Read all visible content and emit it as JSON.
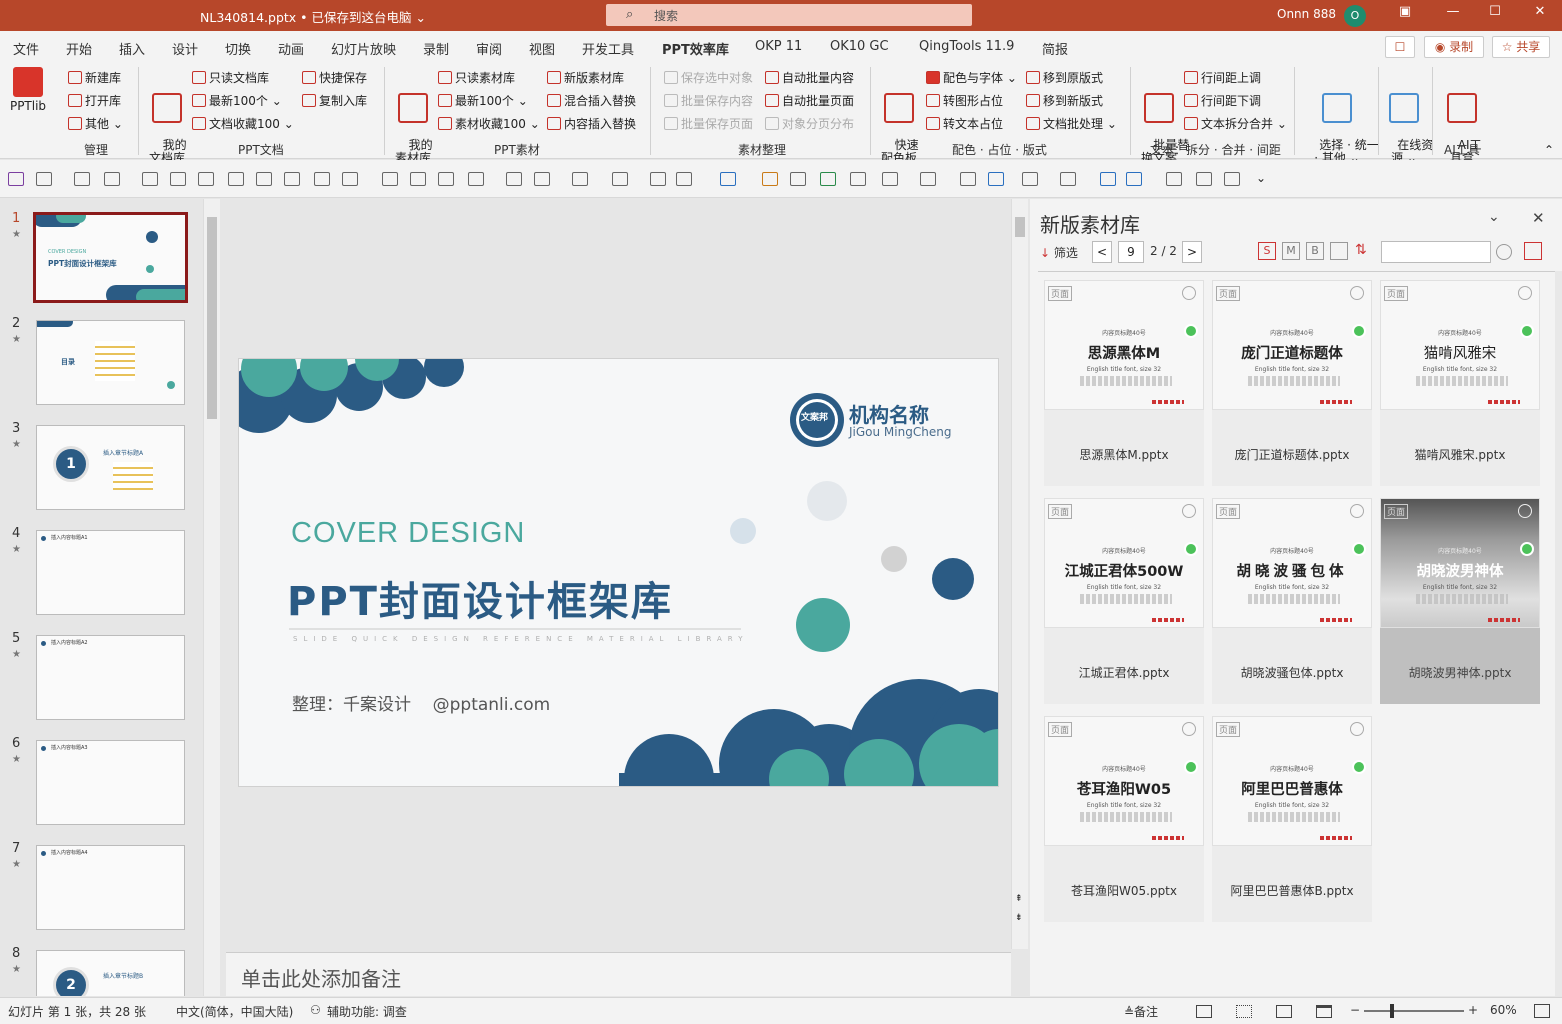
{
  "window": {
    "title": "NL340814.pptx • 已保存到这台电脑 ⌄",
    "search_placeholder": "搜索",
    "user": "Onnn 888",
    "avatar": "O"
  },
  "menu": [
    "文件",
    "开始",
    "插入",
    "设计",
    "切换",
    "动画",
    "幻灯片放映",
    "录制",
    "审阅",
    "视图",
    "开发工具",
    "PPT效率库",
    "OKP 11",
    "OK10 GC",
    "QingTools 11.9",
    "简报"
  ],
  "menu_right": {
    "record": "◉ 录制",
    "share": "☆ 共享"
  },
  "ribbon": {
    "pptlib": "PPTlib",
    "manage": [
      "新建库",
      "打开库",
      "其他 ⌄"
    ],
    "my_doclib": "我的\n文档库",
    "doc_items": [
      "只读文档库",
      "最新100个 ⌄",
      "文档收藏100 ⌄",
      "快捷保存",
      "复制入库"
    ],
    "my_matlib": "我的\n素材库",
    "mat_items": [
      "只读素材库",
      "最新100个 ⌄",
      "素材收藏100 ⌄",
      "新版素材库",
      "混合插入替换",
      "内容插入替换"
    ],
    "sort_items": [
      "保存选中对象",
      "批量保存内容",
      "批量保存页面",
      "自动批量内容",
      "自动批量页面",
      "对象分页分布"
    ],
    "quick_palette": "快速\n配色板",
    "color_items": [
      "配色与字体 ⌄",
      "转图形占位",
      "转文本占位",
      "移到原版式",
      "移到新版式",
      "文档批处理 ⌄"
    ],
    "batch_text": "批量替\n换文案",
    "text_items": [
      "行间距上调",
      "行间距下调",
      "文本拆分合并 ⌄"
    ],
    "select_other": "选择 · 统一\n· 其他 ⌄",
    "online_res": "在线资\n源 ⌄",
    "ai_tool": "AI工\n具盒",
    "groups": [
      "管理",
      "PPT文档",
      "PPT素材",
      "素材整理",
      "配色 · 占位 · 版式",
      "文本：拆分 · 合并 · 间距",
      "AI工具"
    ]
  },
  "thumbnails": [
    {
      "num": "1",
      "label": "PPT封面设计框架库"
    },
    {
      "num": "2",
      "label": "目录"
    },
    {
      "num": "3",
      "label": "插入章节标题A"
    },
    {
      "num": "4",
      "label": "插入内容标题A1"
    },
    {
      "num": "5",
      "label": "插入内容标题A2"
    },
    {
      "num": "6",
      "label": "插入内容标题A3"
    },
    {
      "num": "7",
      "label": "插入内容标题A4"
    },
    {
      "num": "8",
      "label": "插入章节标题B"
    }
  ],
  "thumb_star": "★",
  "slide": {
    "cover": "COVER DESIGN",
    "title": "PPT封面设计框架库",
    "subtitle": "SLIDE QUICK DESIGN REFERENCE MATERIAL LIBRARY",
    "credit": "整理：千案设计    @pptanli.com",
    "org_cn": "机构名称",
    "org_en": "JiGou MingCheng",
    "logo": "文案邦"
  },
  "notes_placeholder": "单击此处添加备注",
  "panel": {
    "title": "新版素材库",
    "filter": "筛选",
    "page_input": "9",
    "page_count": "2 / 2",
    "view_buttons": [
      "S",
      "M",
      "B"
    ],
    "card_tag": "页面",
    "card_small_title": "内容页标题40号",
    "card_small_en": "English title font, size 32",
    "cards": [
      {
        "font": "思源黑体M",
        "file": "思源黑体M.pptx"
      },
      {
        "font": "庞门正道标题体",
        "file": "庞门正道标题体.pptx"
      },
      {
        "font": "猫啃风雅宋",
        "file": "猫啃风雅宋.pptx"
      },
      {
        "font": "江城正君体500W",
        "file": "江城正君体.pptx"
      },
      {
        "font": "胡晓波骚包体",
        "file": "胡晓波骚包体.pptx"
      },
      {
        "font": "胡晓波男神体",
        "file": "胡晓波男神体.pptx"
      },
      {
        "font": "苍耳渔阳W05",
        "file": "苍耳渔阳W05.pptx"
      },
      {
        "font": "阿里巴巴普惠体",
        "file": "阿里巴巴普惠体B.pptx"
      }
    ]
  },
  "status": {
    "slide_info": "幻灯片 第 1 张，共 28 张",
    "language": "中文(简体，中国大陆)",
    "accessibility": "辅助功能: 调查",
    "notes": "≜备注",
    "zoom": "60%",
    "zoom_level": 0.6
  },
  "colors": {
    "accent": "#b7472a",
    "teal": "#4aa89e",
    "navy": "#2b5b84"
  }
}
